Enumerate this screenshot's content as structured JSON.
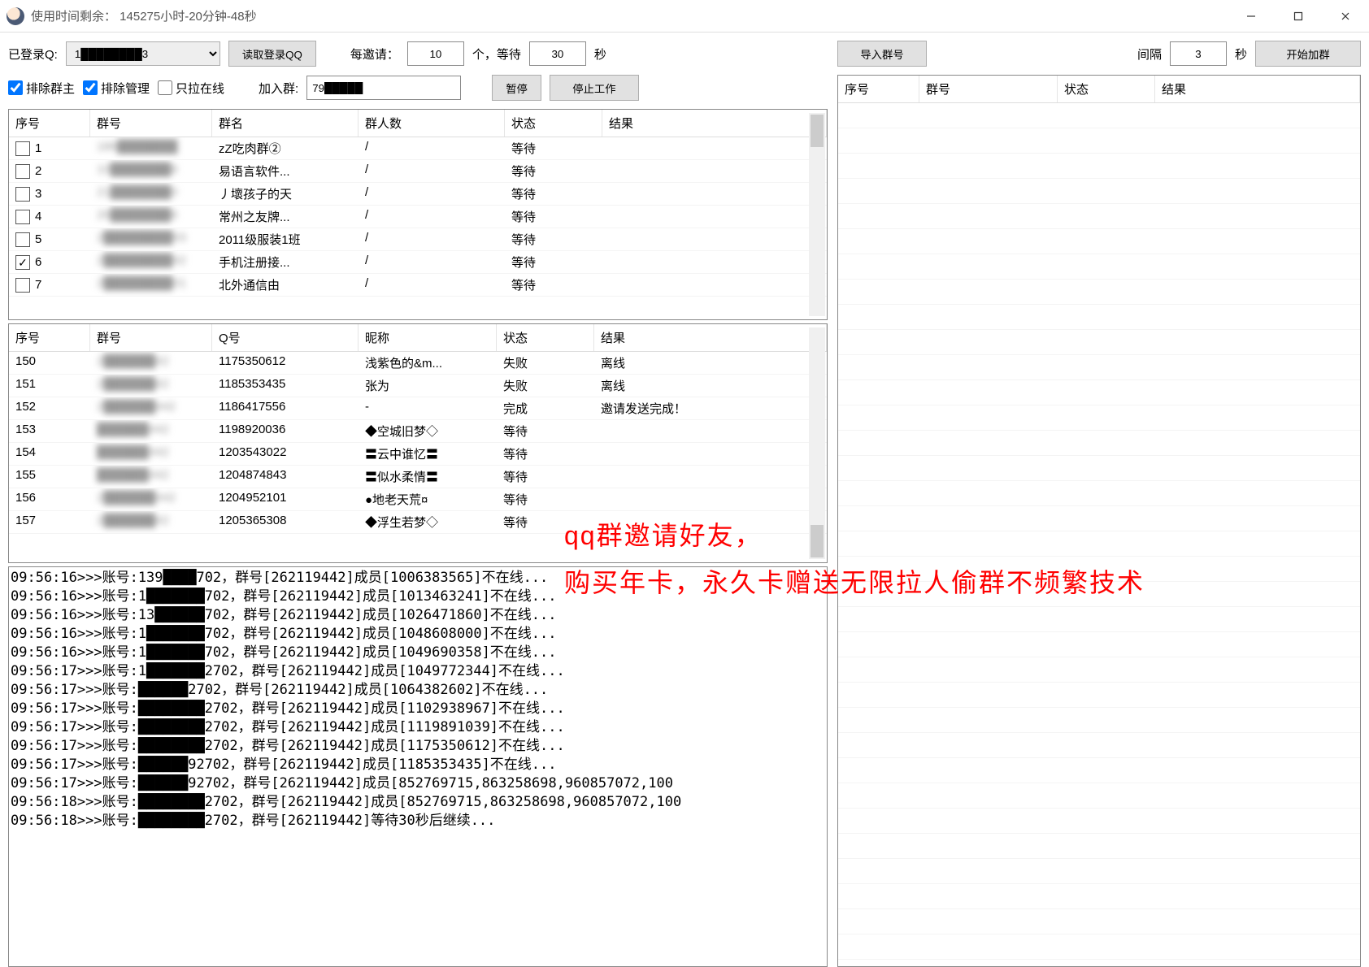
{
  "title": "使用时间剩余：  145275小时-20分钟-48秒",
  "toolbar": {
    "logged_in_label": "已登录Q:",
    "account_display": "1████████3",
    "read_login_btn": "读取登录QQ",
    "per_invite_label": "每邀请：",
    "per_invite_value": "10",
    "unit1": "个，等待",
    "wait_value": "30",
    "unit2": "秒",
    "chk_exclude_owner": "排除群主",
    "chk_exclude_admin": "排除管理",
    "chk_only_online": "只拉在线",
    "join_group_label": "加入群:",
    "join_group_value": "79█████",
    "pause_btn": "暂停",
    "stop_btn": "停止工作"
  },
  "right_bar": {
    "import_btn": "导入群号",
    "interval_label": "间隔",
    "interval_value": "3",
    "sec": "秒",
    "start_btn": "开始加群"
  },
  "tableA": {
    "headers": [
      "序号",
      "群号",
      "群名",
      "群人数",
      "状态",
      "结果"
    ],
    "rows": [
      {
        "chk": false,
        "n": "1",
        "g": "186███████",
        "name": "zZ吃肉群②",
        "p": "/",
        "s": "等待",
        "r": ""
      },
      {
        "chk": false,
        "n": "2",
        "g": "10███████8",
        "name": "易语言软件...",
        "p": "/",
        "s": "等待",
        "r": ""
      },
      {
        "chk": false,
        "n": "3",
        "g": "21███████0",
        "name": "丿壞孩子的天",
        "p": "/",
        "s": "等待",
        "r": ""
      },
      {
        "chk": false,
        "n": "4",
        "g": "26███████6",
        "name": "常州之友牌...",
        "p": "/",
        "s": "等待",
        "r": ""
      },
      {
        "chk": false,
        "n": "5",
        "g": "2████████93",
        "name": "2011级服装1班",
        "p": "/",
        "s": "等待",
        "r": ""
      },
      {
        "chk": true,
        "n": "6",
        "g": "2████████42",
        "name": "手机注册接...",
        "p": "/",
        "s": "等待",
        "r": ""
      },
      {
        "chk": false,
        "n": "7",
        "g": "2████████01",
        "name": "北外通信由",
        "p": "/",
        "s": "等待",
        "r": ""
      }
    ]
  },
  "tableB": {
    "headers": [
      "序号",
      "群号",
      "Q号",
      "昵称",
      "状态",
      "结果"
    ],
    "rows": [
      {
        "n": "150",
        "g": "2██████42",
        "q": "1175350612",
        "nick": "浅紫色的&m...",
        "s": "失败",
        "r": "离线"
      },
      {
        "n": "151",
        "g": "2██████42",
        "q": "1185353435",
        "nick": "张为",
        "s": "失败",
        "r": "离线"
      },
      {
        "n": "152",
        "g": "2██████442",
        "q": "1186417556",
        "nick": "-",
        "s": "完成",
        "r": "邀请发送完成！"
      },
      {
        "n": "153",
        "g": "██████442",
        "q": "1198920036",
        "nick": "◆空城旧梦◇",
        "s": "等待",
        "r": ""
      },
      {
        "n": "154",
        "g": "██████442",
        "q": "1203543022",
        "nick": "〓云中谁忆〓",
        "s": "等待",
        "r": ""
      },
      {
        "n": "155",
        "g": "██████442",
        "q": "1204874843",
        "nick": "〓似水柔情〓",
        "s": "等待",
        "r": ""
      },
      {
        "n": "156",
        "g": "2██████442",
        "q": "1204952101",
        "nick": "●地老天荒¤",
        "s": "等待",
        "r": ""
      },
      {
        "n": "157",
        "g": "2██████42",
        "q": "1205365308",
        "nick": "◆浮生若梦◇",
        "s": "等待",
        "r": ""
      }
    ]
  },
  "tableC": {
    "headers": [
      "序号",
      "群号",
      "状态",
      "结果"
    ]
  },
  "log": [
    "09:56:16>>>账号:139████702，群号[262119442]成员[1006383565]不在线...",
    "09:56:16>>>账号:1███████702，群号[262119442]成员[1013463241]不在线...",
    "09:56:16>>>账号:13██████702，群号[262119442]成员[1026471860]不在线...",
    "09:56:16>>>账号:1███████702，群号[262119442]成员[1048608000]不在线...",
    "09:56:16>>>账号:1███████702，群号[262119442]成员[1049690358]不在线...",
    "09:56:17>>>账号:1███████2702，群号[262119442]成员[1049772344]不在线...",
    "09:56:17>>>账号:██████2702，群号[262119442]成员[1064382602]不在线...",
    "09:56:17>>>账号:████████2702，群号[262119442]成员[1102938967]不在线...",
    "09:56:17>>>账号:████████2702，群号[262119442]成员[1119891039]不在线...",
    "09:56:17>>>账号:████████2702，群号[262119442]成员[1175350612]不在线...",
    "09:56:17>>>账号:██████92702，群号[262119442]成员[1185353435]不在线...",
    "09:56:17>>>账号:██████92702，群号[262119442]成员[852769715,863258698,960857072,100",
    "09:56:18>>>账号:████████2702，群号[262119442]成员[852769715,863258698,960857072,100",
    "09:56:18>>>账号:████████2702，群号[262119442]等待30秒后继续..."
  ],
  "overlay": {
    "line1": "qq群邀请好友，",
    "line2": "购买年卡，永久卡赠送无限拉人偷群不频繁技术"
  }
}
